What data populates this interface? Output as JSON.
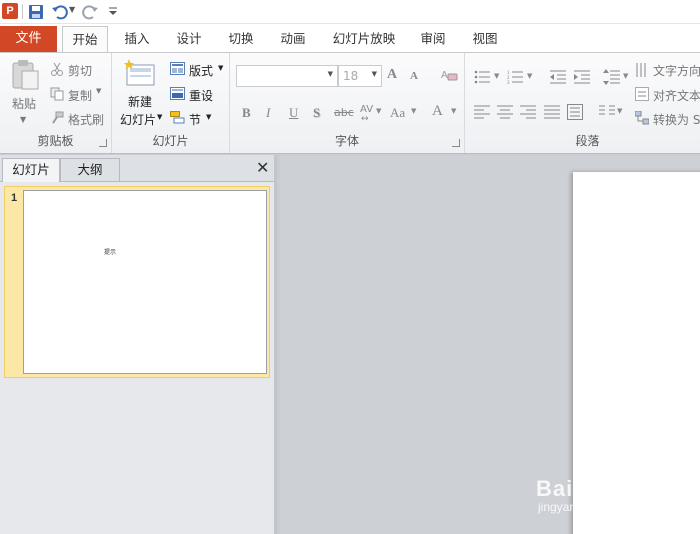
{
  "app": {
    "logo_letter": "P"
  },
  "tabs": {
    "file": "文件",
    "items": [
      "开始",
      "插入",
      "设计",
      "切换",
      "动画",
      "幻灯片放映",
      "审阅",
      "视图"
    ]
  },
  "ribbon": {
    "clipboard": {
      "paste": "粘贴",
      "cut": "剪切",
      "copy": "复制",
      "format_painter": "格式刷",
      "label": "剪贴板"
    },
    "slides": {
      "new_slide_line1": "新建",
      "new_slide_line2": "幻灯片",
      "layout": "版式",
      "reset": "重设",
      "section": "节",
      "label": "幻灯片"
    },
    "font": {
      "font_name": "",
      "font_size": "18",
      "grow": "A",
      "shrink": "A",
      "bold": "B",
      "italic": "I",
      "underline": "U",
      "shadow": "S",
      "strike": "abc",
      "spacing": "AV",
      "case": "Aa",
      "color": "A",
      "label": "字体"
    },
    "paragraph": {
      "text_direction": "文字方向",
      "align_text": "对齐文本",
      "convert_smartart": "转换为 S",
      "label": "段落"
    }
  },
  "left_pane": {
    "tab_slides": "幻灯片",
    "tab_outline": "大纲",
    "close": "✕",
    "slide_number": "1",
    "slide_text": "提示"
  },
  "watermark": {
    "main": "Baidu 经验",
    "sub": "jingyan.baidu.com"
  },
  "colors": {
    "file_tab": "#d24726",
    "selected_thumb": "#fbe8a6",
    "ribbon_bg": "#f3f4f6"
  }
}
